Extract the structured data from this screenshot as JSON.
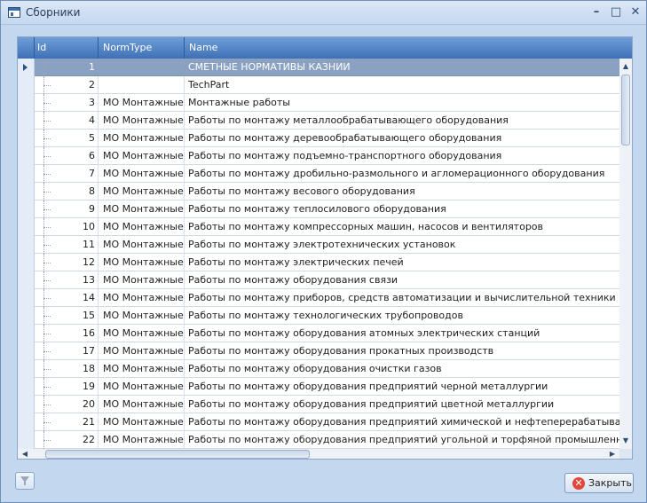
{
  "window": {
    "title": "Сборники",
    "icon": "window-icon",
    "controls": [
      "minimize",
      "maximize",
      "close"
    ]
  },
  "grid": {
    "columns": [
      "Id",
      "NormType",
      "Name"
    ],
    "selected_row": 0,
    "rows": [
      {
        "id": "1",
        "normtype": "",
        "name": "СМЕТНЫЕ НОРМАТИВЫ КАЗНИИ"
      },
      {
        "id": "2",
        "normtype": "",
        "name": "TechPart"
      },
      {
        "id": "3",
        "normtype": "МО Монтажные",
        "name": "Монтажные работы"
      },
      {
        "id": "4",
        "normtype": "МО Монтажные",
        "name": "Работы по монтажу металлообрабатывающего оборудования"
      },
      {
        "id": "5",
        "normtype": "МО Монтажные",
        "name": "Работы по монтажу деревообрабатывающего оборудования"
      },
      {
        "id": "6",
        "normtype": "МО Монтажные",
        "name": "Работы по монтажу подъемно-транспортного оборудования"
      },
      {
        "id": "7",
        "normtype": "МО Монтажные",
        "name": "Работы по монтажу дробильно-размольного и агломерационного оборудования"
      },
      {
        "id": "8",
        "normtype": "МО Монтажные",
        "name": "Работы по монтажу весового оборудования"
      },
      {
        "id": "9",
        "normtype": "МО Монтажные",
        "name": "Работы по монтажу теплосилового оборудования"
      },
      {
        "id": "10",
        "normtype": "МО Монтажные",
        "name": "Работы по монтажу компрессорных машин, насосов и вентиляторов"
      },
      {
        "id": "11",
        "normtype": "МО Монтажные",
        "name": "Работы по монтажу электротехнических установок"
      },
      {
        "id": "12",
        "normtype": "МО Монтажные",
        "name": "Работы по монтажу электрических печей"
      },
      {
        "id": "13",
        "normtype": "МО Монтажные",
        "name": "Работы по монтажу оборудования связи"
      },
      {
        "id": "14",
        "normtype": "МО Монтажные",
        "name": "Работы по монтажу приборов, средств автоматизации и вычислительной техники"
      },
      {
        "id": "15",
        "normtype": "МО Монтажные",
        "name": "Работы по монтажу технологических трубопроводов"
      },
      {
        "id": "16",
        "normtype": "МО Монтажные",
        "name": "Работы по монтажу оборудования атомных электрических станций"
      },
      {
        "id": "17",
        "normtype": "МО Монтажные",
        "name": "Работы по монтажу оборудования прокатных производств"
      },
      {
        "id": "18",
        "normtype": "МО Монтажные",
        "name": "Работы по монтажу оборудования очистки газов"
      },
      {
        "id": "19",
        "normtype": "МО Монтажные",
        "name": "Работы по монтажу оборудования предприятий черной металлургии"
      },
      {
        "id": "20",
        "normtype": "МО Монтажные",
        "name": "Работы по монтажу оборудования предприятий цветной металлургии"
      },
      {
        "id": "21",
        "normtype": "МО Монтажные",
        "name": "Работы по монтажу оборудования предприятий химической и нефтеперерабатывающей промышленности"
      },
      {
        "id": "22",
        "normtype": "МО Монтажные",
        "name": "Работы по монтажу оборудования предприятий угольной и торфяной промышленности"
      }
    ]
  },
  "footer": {
    "filter_icon": "funnel-icon",
    "close_label": "Закрыть",
    "close_icon": "close-x-icon"
  },
  "colors": {
    "header": "#3f70b6",
    "selected_row": "#8aa1c1",
    "close_icon": "#e4473a"
  }
}
